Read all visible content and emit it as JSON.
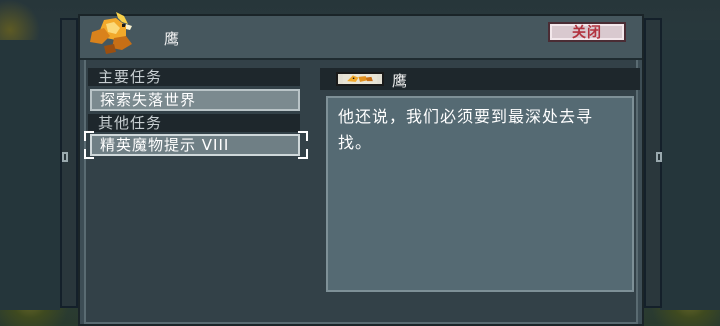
{
  "dialog": {
    "title": "鹰",
    "close_label": "关闭"
  },
  "quest_list": {
    "main_section": "主要任务",
    "main_items": [
      "探索失落世界"
    ],
    "other_section": "其他任务",
    "other_items": [
      "精英魔物提示 VIII"
    ],
    "selected": "精英魔物提示 VIII"
  },
  "detail": {
    "npc_name": "鹰",
    "text": "他还说，我们必须要到最深处去寻找。"
  },
  "colors": {
    "close_text": "#b2323e",
    "panel": "#334148",
    "section_bar": "#1e272c",
    "detail_box": "#556a73"
  },
  "icons": {
    "header": "eagle-icon",
    "detail": "eagle-portrait-icon"
  }
}
